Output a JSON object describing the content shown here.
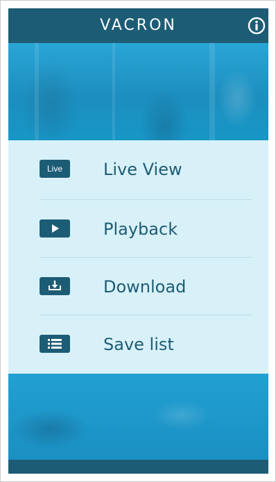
{
  "header": {
    "brand": "VACRON",
    "info_icon": "info-icon"
  },
  "menu": {
    "items": [
      {
        "label": "Live View",
        "icon": "live-icon",
        "icon_text": "Live"
      },
      {
        "label": "Playback",
        "icon": "play-icon"
      },
      {
        "label": "Download",
        "icon": "download-icon"
      },
      {
        "label": "Save list",
        "icon": "list-icon"
      }
    ]
  },
  "colors": {
    "primary_dark": "#1d5c75",
    "menu_background": "#d8f1f8",
    "photo_blue": "#1aa3d4",
    "divider": "#b9dbe6"
  }
}
